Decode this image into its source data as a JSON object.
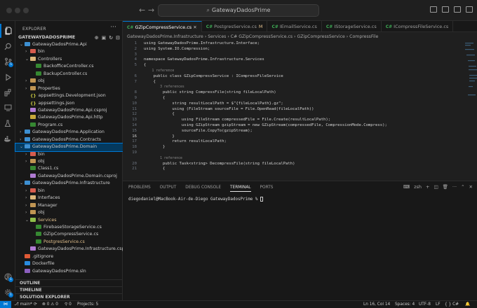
{
  "titlebar": {
    "search_text": "GatewayDadosPrime"
  },
  "explorer": {
    "title": "EXPLORER",
    "workspace": "GATEWAYDADOSPRIME",
    "tree": [
      {
        "label": "GatewayDadosPrime.Api",
        "indent": 0,
        "chev": "⌄",
        "kind": "fold-blue"
      },
      {
        "label": "bin",
        "indent": 1,
        "chev": "›",
        "kind": "fold-red"
      },
      {
        "label": "Controllers",
        "indent": 1,
        "chev": "⌄",
        "kind": "fold-c"
      },
      {
        "label": "BackofficeController.cs",
        "indent": 2,
        "chev": "",
        "kind": "cs"
      },
      {
        "label": "BackupController.cs",
        "indent": 2,
        "chev": "",
        "kind": "cs"
      },
      {
        "label": "obj",
        "indent": 1,
        "chev": "›",
        "kind": "fold"
      },
      {
        "label": "Properties",
        "indent": 1,
        "chev": "›",
        "kind": "fold"
      },
      {
        "label": "appsettings.Development.json",
        "indent": 1,
        "chev": "",
        "kind": "json"
      },
      {
        "label": "appsettings.json",
        "indent": 1,
        "chev": "",
        "kind": "json"
      },
      {
        "label": "GatewayDadosPrime.Api.csproj",
        "indent": 1,
        "chev": "",
        "kind": "csproj"
      },
      {
        "label": "GatewayDadosPrime.Api.http",
        "indent": 1,
        "chev": "",
        "kind": "http"
      },
      {
        "label": "Program.cs",
        "indent": 1,
        "chev": "",
        "kind": "cs"
      },
      {
        "label": "GatewayDadosPrime.Application",
        "indent": 0,
        "chev": "›",
        "kind": "fold-blue"
      },
      {
        "label": "GatewayDadosPrime.Contracts",
        "indent": 0,
        "chev": "›",
        "kind": "fold-blue"
      },
      {
        "label": "GatewayDadosPrime.Domain",
        "indent": 0,
        "chev": "⌄",
        "kind": "fold-blue",
        "selected": true
      },
      {
        "label": "bin",
        "indent": 1,
        "chev": "›",
        "kind": "fold-red"
      },
      {
        "label": "obj",
        "indent": 1,
        "chev": "›",
        "kind": "fold"
      },
      {
        "label": "Class1.cs",
        "indent": 1,
        "chev": "",
        "kind": "cs"
      },
      {
        "label": "GatewayDadosPrime.Domain.csproj",
        "indent": 1,
        "chev": "",
        "kind": "csproj"
      },
      {
        "label": "GatewayDadosPrime.Infrastructure",
        "indent": 0,
        "chev": "⌄",
        "kind": "fold-blue"
      },
      {
        "label": "bin",
        "indent": 1,
        "chev": "›",
        "kind": "fold-red"
      },
      {
        "label": "Interfaces",
        "indent": 1,
        "chev": "›",
        "kind": "fold-c"
      },
      {
        "label": "Manager",
        "indent": 1,
        "chev": "›",
        "kind": "fold"
      },
      {
        "label": "obj",
        "indent": 1,
        "chev": "›",
        "kind": "fold"
      },
      {
        "label": "Services",
        "indent": 1,
        "chev": "⌄",
        "kind": "fold-green",
        "accent": "#e2c08d"
      },
      {
        "label": "FirebaseStorageService.cs",
        "indent": 2,
        "chev": "",
        "kind": "cs"
      },
      {
        "label": "GZipCompressService.cs",
        "indent": 2,
        "chev": "",
        "kind": "cs"
      },
      {
        "label": "PostgresService.cs",
        "indent": 2,
        "chev": "",
        "kind": "cs",
        "accent": "#e2c08d"
      },
      {
        "label": "GatewayDadosPrime.Infrastructure.csp...",
        "indent": 1,
        "chev": "",
        "kind": "csproj"
      },
      {
        "label": ".gitignore",
        "indent": 0,
        "chev": "",
        "kind": "git"
      },
      {
        "label": "Dockerfile",
        "indent": 0,
        "chev": "",
        "kind": "docker"
      },
      {
        "label": "GatewayDadosPrime.sln",
        "indent": 0,
        "chev": "",
        "kind": "sln"
      }
    ],
    "sections": [
      "OUTLINE",
      "TIMELINE",
      "SOLUTION EXPLORER"
    ]
  },
  "tabs": [
    {
      "label": "GZipCompressService.cs",
      "active": true
    },
    {
      "label": "PostgresService.cs",
      "modified": "M"
    },
    {
      "label": "IEmailService.cs"
    },
    {
      "label": "IStorageService.cs"
    },
    {
      "label": "ICompressFileService.cs"
    }
  ],
  "breadcrumb": "GatewayDadosPrime.Infrastructure › Services › C# GZipCompressService.cs › GZipCompressService › CompressFile",
  "code": [
    {
      "n": "1",
      "t": "using GatewayDadosPrime.Infrastructure.Interface;"
    },
    {
      "n": "2",
      "t": "using System.IO.Compression;"
    },
    {
      "n": "3",
      "t": ""
    },
    {
      "n": "4",
      "t": "namespace GatewayDadosPrime.Infrastructure.Services"
    },
    {
      "n": "5",
      "t": "{"
    },
    {
      "n": "",
      "t": "    1 reference",
      "ref": true
    },
    {
      "n": "6",
      "t": "    public class GZipCompressService : ICompressFileService"
    },
    {
      "n": "7",
      "t": "    {"
    },
    {
      "n": "",
      "t": "        3 references",
      "ref": true
    },
    {
      "n": "8",
      "t": "        public string CompressFile(string fileLocalPath)"
    },
    {
      "n": "9",
      "t": "        {"
    },
    {
      "n": "10",
      "t": "            string resultLocalPath = $\"{fileLocalPath}.gz\";"
    },
    {
      "n": "11",
      "t": "            using (FileStream sourceFile = File.OpenRead(fileLocalPath))"
    },
    {
      "n": "12",
      "t": "            {"
    },
    {
      "n": "13",
      "t": "                using FileStream compressedFile = File.Create(resultLocalPath);"
    },
    {
      "n": "14",
      "t": "                using GZipStream gzipStream = new GZipStream(compressedFile, CompressionMode.Compress);"
    },
    {
      "n": "15",
      "t": "                sourceFile.CopyTo(gzipStream);"
    },
    {
      "n": "16",
      "t": "            }"
    },
    {
      "n": "17",
      "t": "            return resultLocalPath;"
    },
    {
      "n": "18",
      "t": "        }"
    },
    {
      "n": "19",
      "t": ""
    },
    {
      "n": "",
      "t": "        1 reference",
      "ref": true
    },
    {
      "n": "20",
      "t": "        public Task<string> DecompressFile(string fileLocalPath)"
    },
    {
      "n": "21",
      "t": "        {"
    }
  ],
  "panel": {
    "tabs": [
      "PROBLEMS",
      "OUTPUT",
      "DEBUG CONSOLE",
      "TERMINAL",
      "PORTS"
    ],
    "active": "TERMINAL",
    "shell": "zsh",
    "prompt": "diegodaniel@MacBook-Air-de-Diego GatewayDadosPrime % "
  },
  "status": {
    "branch": "main*",
    "sync": "⟳",
    "errors": "0",
    "warnings": "0",
    "ports": "0",
    "projects": "Projects: 5",
    "position": "Ln 16, Col 14",
    "spaces": "Spaces: 4",
    "encoding": "UTF-8",
    "eol": "LF",
    "lang": "C#"
  },
  "colors": {
    "accent": "#0078d4",
    "selection": "#04395e"
  }
}
